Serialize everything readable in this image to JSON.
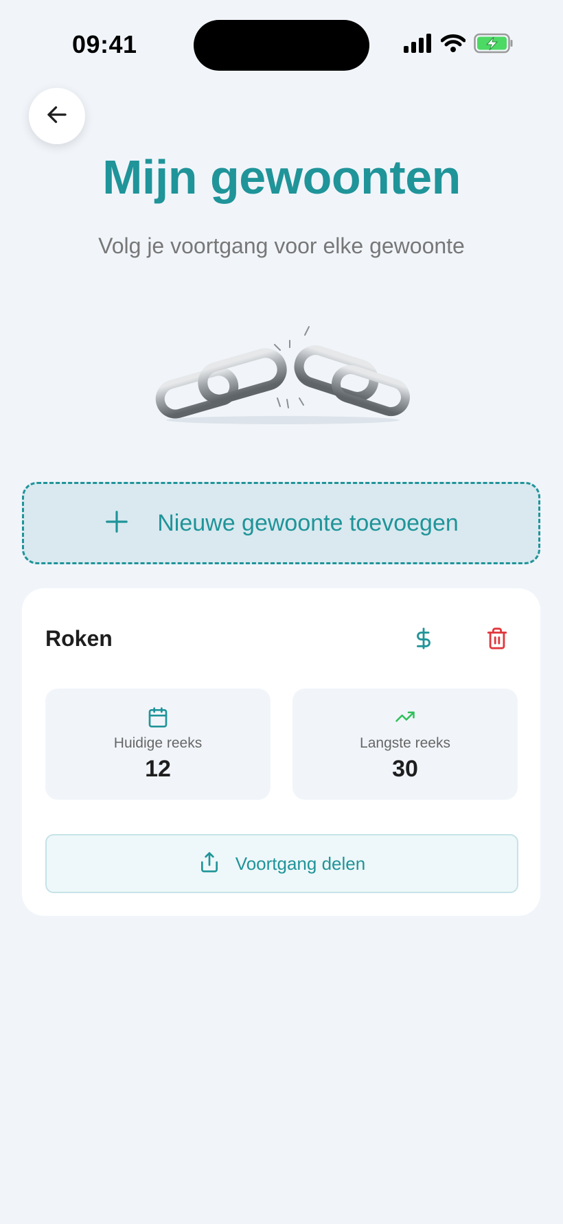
{
  "status_bar": {
    "time": "09:41",
    "icons": [
      "cellular-signal-icon",
      "wifi-icon",
      "battery-charging-icon"
    ]
  },
  "header": {
    "back_icon": "arrow-left-icon",
    "title": "Mijn gewoonten",
    "subtitle": "Volg je voortgang voor elke gewoonte"
  },
  "hero": {
    "image": "broken-chain-illustration"
  },
  "add_habit": {
    "icon": "plus-icon",
    "label": "Nieuwe gewoonte toevoegen"
  },
  "habits": [
    {
      "name": "Roken",
      "actions": [
        {
          "icon": "dollar-icon"
        },
        {
          "icon": "trash-icon"
        }
      ],
      "stats": {
        "current": {
          "icon": "calendar-icon",
          "label": "Huidige reeks",
          "value": "12"
        },
        "longest": {
          "icon": "trending-up-icon",
          "label": "Langste reeks",
          "value": "30"
        }
      },
      "share": {
        "icon": "share-icon",
        "label": "Voortgang delen"
      }
    }
  ],
  "colors": {
    "accent": "#1F9499",
    "background": "#F1F5FA",
    "danger": "#E0363B",
    "success": "#2FBF5A",
    "battery": "#4CD964"
  }
}
